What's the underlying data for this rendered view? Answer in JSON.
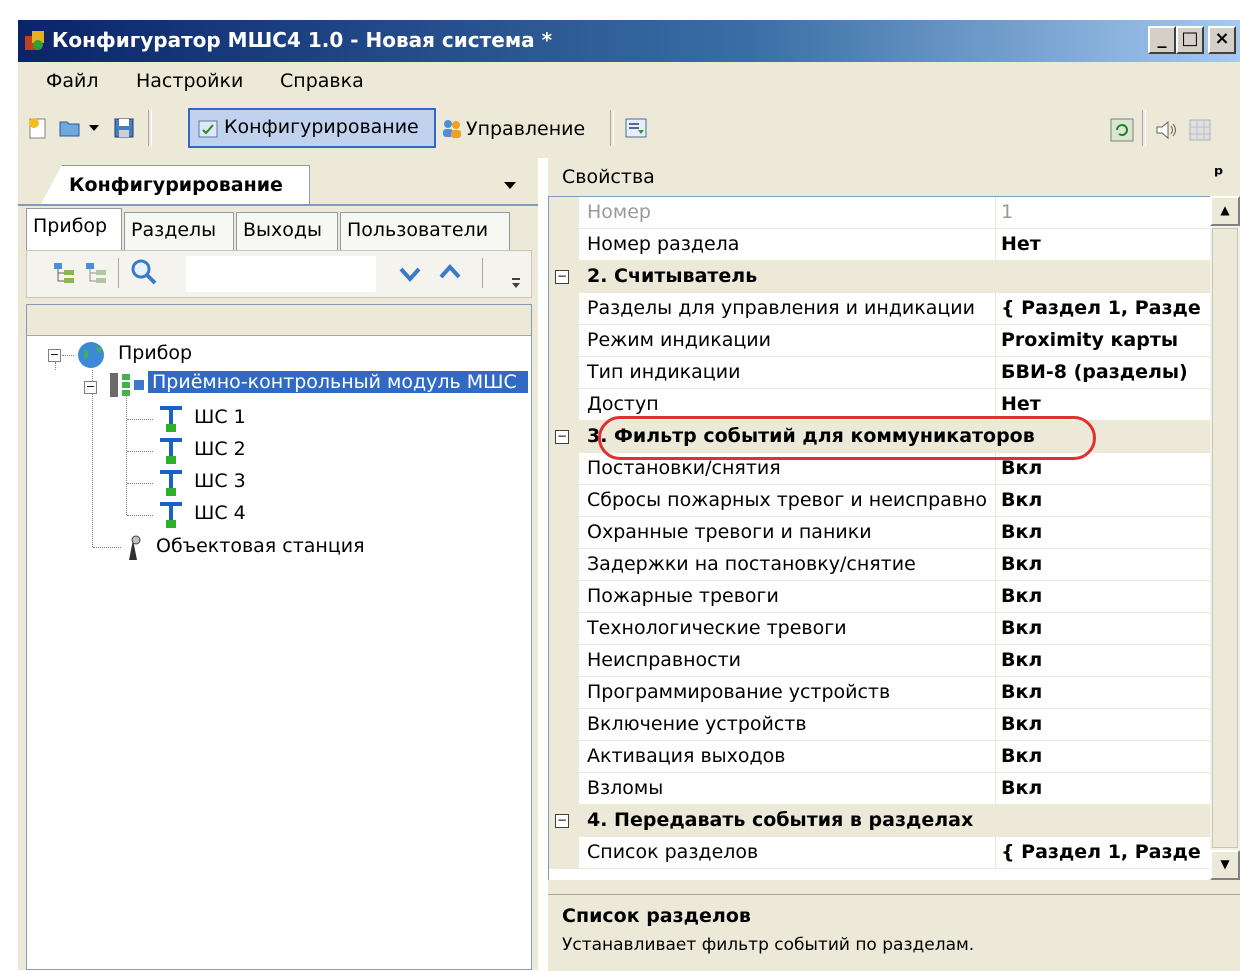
{
  "window": {
    "title": "Конфигуратор МШС4 1.0 - Новая система *",
    "minimize": "_",
    "maximize": "□",
    "close": "×"
  },
  "menu": {
    "items": [
      "Файл",
      "Настройки",
      "Справка"
    ]
  },
  "toolbar": {
    "config_label": "Конфигурирование",
    "manage_label": "Управление"
  },
  "left_panel": {
    "tab_title": "Конфигурирование",
    "subtabs": [
      "Прибор",
      "Разделы",
      "Выходы",
      "Пользователи"
    ],
    "search": {
      "value": ""
    },
    "tree": {
      "root": "Прибор",
      "module": "Приёмно-контрольный модуль МШС",
      "loops": [
        "ШС 1",
        "ШС 2",
        "ШС 3",
        "ШС 4"
      ],
      "station": "Объектовая станция"
    }
  },
  "properties": {
    "header": "Свойства",
    "pin": "ᵖ",
    "rows": [
      {
        "kind": "prop",
        "disabled": true,
        "name": "Номер",
        "value": "1"
      },
      {
        "kind": "prop",
        "name": "Номер раздела",
        "value": "Нет"
      },
      {
        "kind": "cat",
        "name": "2. Считыватель"
      },
      {
        "kind": "prop",
        "name": "Разделы для управления и индикации",
        "value": "{ Раздел 1, Разде"
      },
      {
        "kind": "prop",
        "name": "Режим индикации",
        "value": "Proximity карты"
      },
      {
        "kind": "prop",
        "name": "Тип индикации",
        "value": "БВИ-8 (разделы)"
      },
      {
        "kind": "prop",
        "name": "Доступ",
        "value": "Нет"
      },
      {
        "kind": "cat",
        "name": "3. Фильтр событий для коммуникаторов"
      },
      {
        "kind": "prop",
        "name": "Постановки/снятия",
        "value": "Вкл"
      },
      {
        "kind": "prop",
        "name": "Сбросы пожарных тревог и неисправно",
        "value": "Вкл"
      },
      {
        "kind": "prop",
        "name": "Охранные тревоги и паники",
        "value": "Вкл"
      },
      {
        "kind": "prop",
        "name": "Задержки на постановку/снятие",
        "value": "Вкл"
      },
      {
        "kind": "prop",
        "name": "Пожарные тревоги",
        "value": "Вкл"
      },
      {
        "kind": "prop",
        "name": "Технологические тревоги",
        "value": "Вкл"
      },
      {
        "kind": "prop",
        "name": "Неисправности",
        "value": "Вкл"
      },
      {
        "kind": "prop",
        "name": "Программирование устройств",
        "value": "Вкл"
      },
      {
        "kind": "prop",
        "name": "Включение устройств",
        "value": "Вкл"
      },
      {
        "kind": "prop",
        "name": "Активация выходов",
        "value": "Вкл"
      },
      {
        "kind": "prop",
        "name": "Взломы",
        "value": "Вкл"
      },
      {
        "kind": "cat",
        "name": "4. Передавать события в разделах"
      },
      {
        "kind": "prop",
        "name": "Список разделов",
        "value": "{ Раздел 1, Разде"
      }
    ],
    "description_title": "Список разделов",
    "description_text": "Устанавливает фильтр событий по разделам.",
    "highlight_color": "#e03030"
  }
}
